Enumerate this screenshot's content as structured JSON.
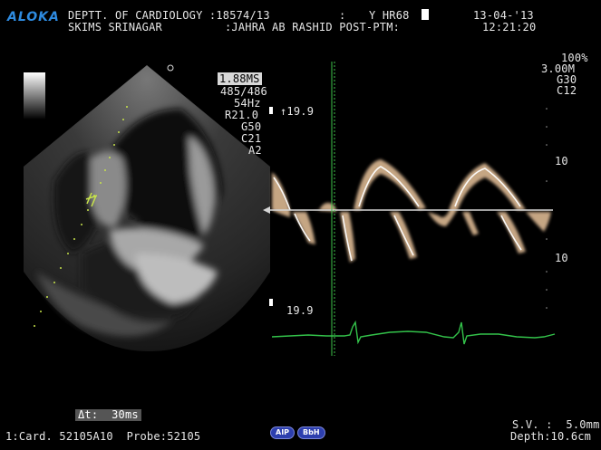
{
  "header": {
    "brand": "ALOKA",
    "line1": "DEPTT. OF CARDIOLOGY :18574/13",
    "line2": "SKIMS SRINAGAR",
    "colon": ":",
    "patient_id": "Y HR68",
    "patient_name": ":JAHRA AB RASHID POST-PTM:",
    "date": "13-04-'13",
    "time": "12:21:20"
  },
  "image_params": {
    "frame_time": "1.88MS",
    "frame_count": "485/486",
    "frame_rate": "54Hz",
    "r": "R21.0",
    "gain": "G50",
    "contrast": "C21",
    "mode": "A2"
  },
  "doppler_params": {
    "power": "100%",
    "freq": "3.00M",
    "gain": "G30",
    "contrast": "C12"
  },
  "doppler_scale": {
    "top_value": "↑19.9",
    "bottom_value": "19.9",
    "tick_upper": "10",
    "tick_lower": "10"
  },
  "measure": {
    "delta_t": "Δt:  30ms"
  },
  "footer": {
    "probe_info": "1:Card. 52105A10  Probe:52105",
    "aip_button": "AIP",
    "bbh_button": "BbH",
    "sample_volume": "S.V. :  5.0mm",
    "depth": "Depth:10.6cm"
  },
  "colors": {
    "brand": "#2e8be0",
    "ecg": "#33c24a",
    "doppler": "#e8c39b",
    "marker": "#c7e34b"
  },
  "icons": {
    "grayscale_bar": "grayscale-bar-icon",
    "orientation_dot": "orientation-dot-icon",
    "cursor_arrow": "cursor-arrow-icon"
  }
}
